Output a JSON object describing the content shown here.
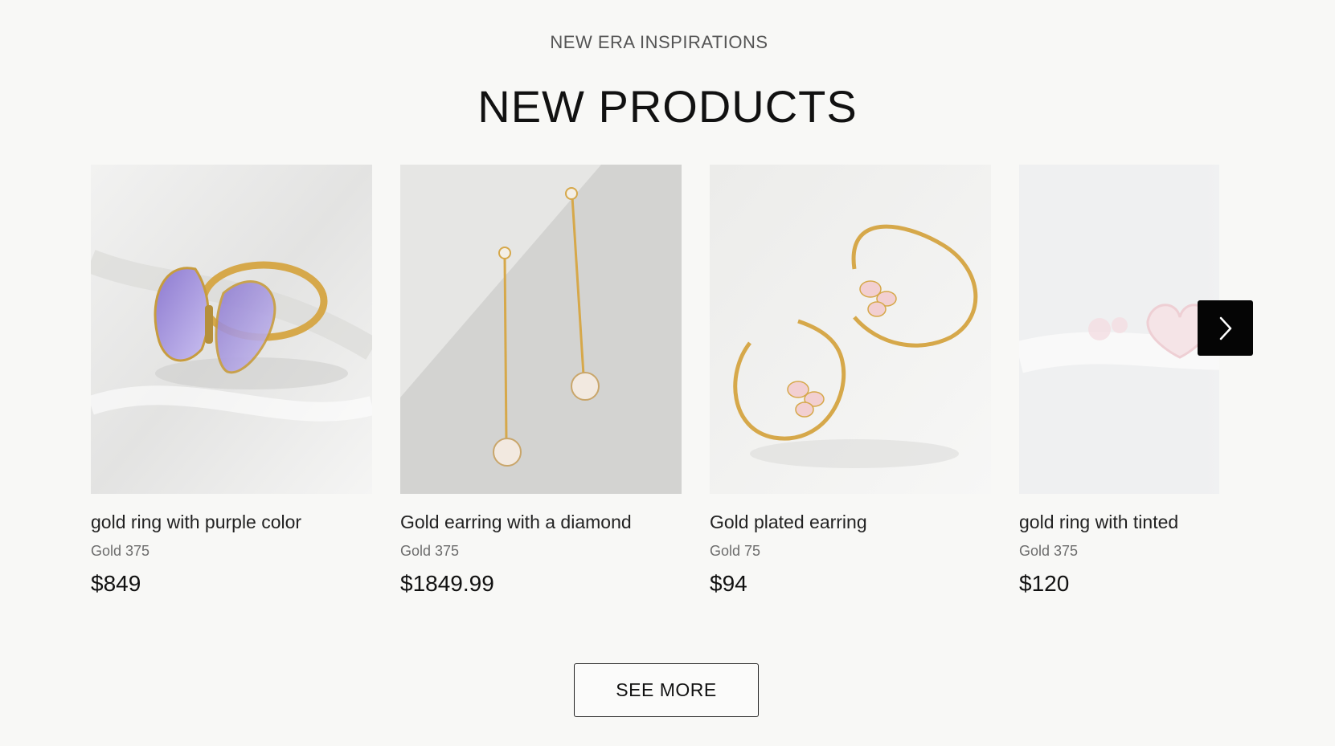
{
  "section": {
    "eyebrow": "NEW ERA INSPIRATIONS",
    "title": "NEW PRODUCTS"
  },
  "products": [
    {
      "name": "gold ring with purple color",
      "material": "Gold 375",
      "price": "$849"
    },
    {
      "name": "Gold earring with a diamond",
      "material": "Gold 375",
      "price": "$1849.99"
    },
    {
      "name": "Gold plated earring",
      "material": "Gold 75",
      "price": "$94"
    },
    {
      "name": "gold ring with tinted",
      "material": "Gold 375",
      "price": "$120"
    }
  ],
  "see_more_label": "SEE MORE",
  "icons": {
    "next": "chevron-right-icon"
  },
  "colors": {
    "background": "#f8f8f6",
    "next_button": "#050505",
    "gold": "#d6a84a"
  }
}
